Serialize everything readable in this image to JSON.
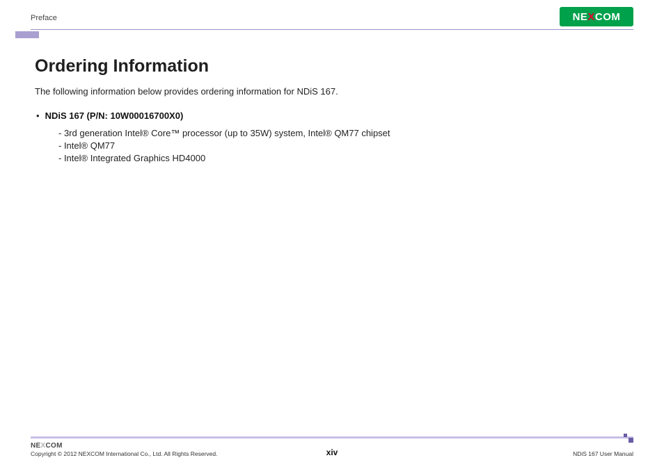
{
  "header": {
    "section": "Preface",
    "brand": "NEXCOM"
  },
  "content": {
    "title": "Ordering Information",
    "intro": "The following information below provides ordering information for NDiS 167.",
    "product": {
      "heading": "NDiS 167 (P/N: 10W00016700X0)",
      "details": [
        "- 3rd generation Intel® Core™ processor (up to 35W) system, Intel® QM77 chipset",
        "- Intel® QM77",
        "- Intel® Integrated Graphics HD4000"
      ]
    }
  },
  "footer": {
    "copyright": "Copyright © 2012 NEXCOM International Co., Ltd. All Rights Reserved.",
    "page": "xiv",
    "manual": "NDiS 167 User Manual"
  }
}
